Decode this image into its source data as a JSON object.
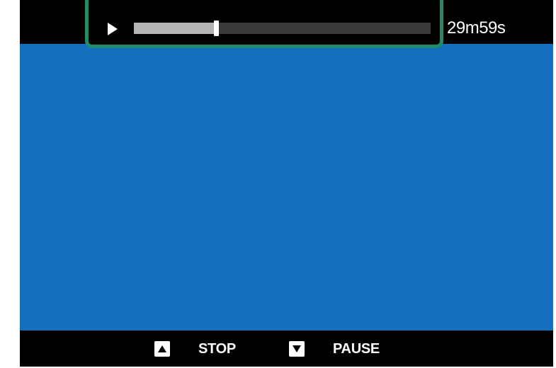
{
  "player": {
    "state_icon": "play-icon",
    "progress_fraction": 0.27,
    "time_readout": "29m59s"
  },
  "controls": {
    "stop": {
      "icon": "up-arrow-key-icon",
      "label": "STOP"
    },
    "pause": {
      "icon": "down-arrow-key-icon",
      "label": "PAUSE"
    }
  },
  "colors": {
    "video_area": "#146ec0",
    "highlight_border": "#1f8a6c",
    "progress_fill": "#b4b4b4",
    "progress_track": "#3b3b3b"
  }
}
